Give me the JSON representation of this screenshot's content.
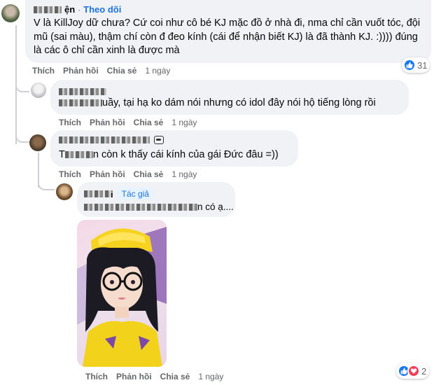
{
  "comment1": {
    "follow_label": "Theo dõi",
    "text": "V là KillJoy dữ chưa? Cứ coi như cô bé KJ mặc đồ ở nhà đi, nma chỉ cần vuốt tóc, đội mũ (sai màu), thậm chí còn đ đeo kính (cái để nhận biết KJ) là đã thành KJ. :)))) đúng là các ô chỉ cần xinh là được mà",
    "actions": {
      "like": "Thích",
      "reply": "Phản hồi",
      "share": "Chia sẻ",
      "time": "1 ngày"
    },
    "reaction_count": "31"
  },
  "reply1": {
    "text": "uầy, tại hạ ko dám nói nhưng có idol đây nói hộ tiếng lòng rồi",
    "actions": {
      "like": "Thích",
      "reply": "Phản hồi",
      "share": "Chia sẻ",
      "time": "1 ngày"
    }
  },
  "reply2": {
    "text_prefix": "T",
    "text": "n còn k thấy cái kính của gái Đức đâu =))",
    "actions": {
      "like": "Thích",
      "reply": "Phản hồi",
      "share": "Chia sẻ",
      "time": "1 ngày"
    }
  },
  "reply3": {
    "name_suffix": "i",
    "author_badge": "Tác giả",
    "text_suffix": "n có ạ....",
    "actions": {
      "like": "Thích",
      "reply": "Phản hồi",
      "share": "Chia sẻ",
      "time": "1 ngày"
    },
    "reaction_count": "2"
  },
  "colors": {
    "accent": "#1b74e4",
    "bubble": "#f0f2f5",
    "meta": "#65676b",
    "like": "#1877f2",
    "love": "#f33e58"
  }
}
